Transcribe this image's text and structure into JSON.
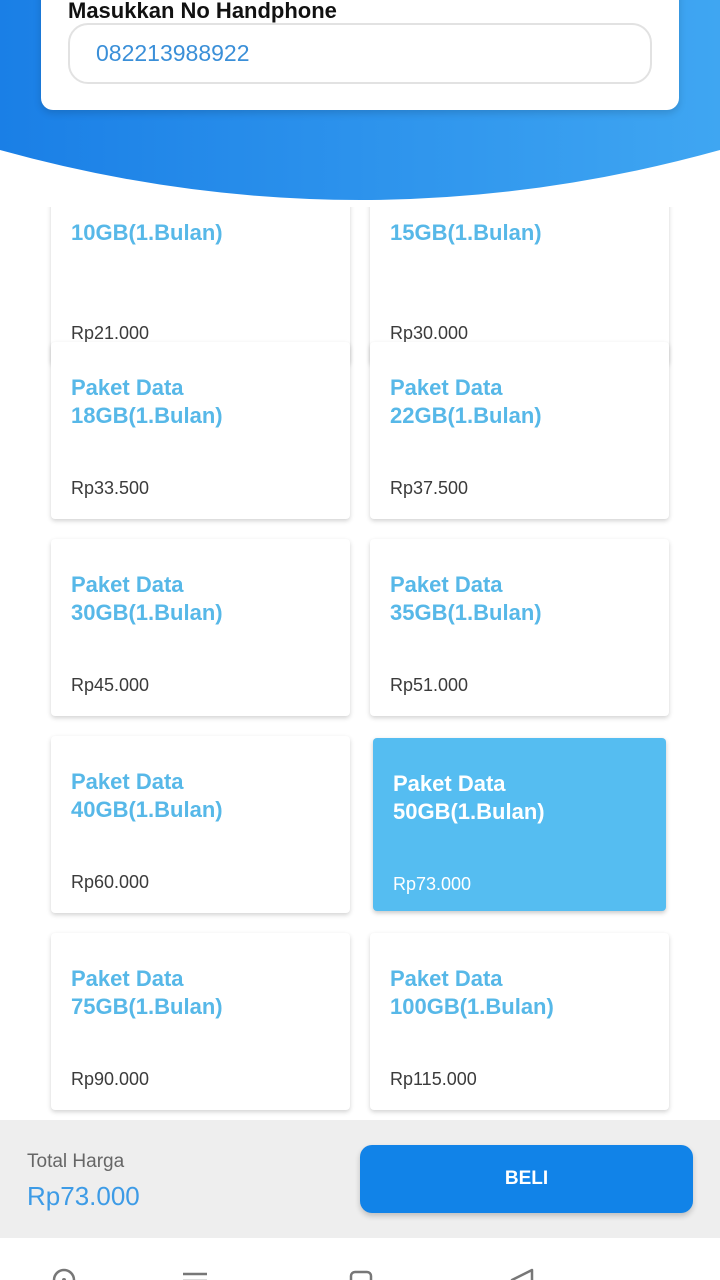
{
  "colors": {
    "header_blue": "#2d8fec",
    "card_title_blue": "#57b8e8",
    "selected_card": "#55bdf1",
    "buy_button": "#1183e8",
    "total_value": "#3d9be6"
  },
  "phone": {
    "label": "Masukkan No Handphone",
    "value": "082213988922"
  },
  "packages": [
    {
      "title": "10GB(1.Bulan)",
      "price": "Rp21.000",
      "selected": false
    },
    {
      "title": "15GB(1.Bulan)",
      "price": "Rp30.000",
      "selected": false
    },
    {
      "title": "Paket Data 18GB(1.Bulan)",
      "price": "Rp33.500",
      "selected": false
    },
    {
      "title": "Paket Data 22GB(1.Bulan)",
      "price": "Rp37.500",
      "selected": false
    },
    {
      "title": "Paket Data 30GB(1.Bulan)",
      "price": "Rp45.000",
      "selected": false
    },
    {
      "title": "Paket Data 35GB(1.Bulan)",
      "price": "Rp51.000",
      "selected": false
    },
    {
      "title": "Paket Data 40GB(1.Bulan)",
      "price": "Rp60.000",
      "selected": false
    },
    {
      "title": "Paket Data 50GB(1.Bulan)",
      "price": "Rp73.000",
      "selected": true
    },
    {
      "title": "Paket Data 75GB(1.Bulan)",
      "price": "Rp90.000",
      "selected": false
    },
    {
      "title": "Paket Data 100GB(1.Bulan)",
      "price": "Rp115.000",
      "selected": false
    }
  ],
  "footer": {
    "total_label": "Total Harga",
    "total_value": "Rp73.000",
    "buy_label": "BELI"
  },
  "navbar": {
    "icons": [
      "home-icon",
      "menu-icon",
      "square-icon",
      "back-icon"
    ]
  }
}
